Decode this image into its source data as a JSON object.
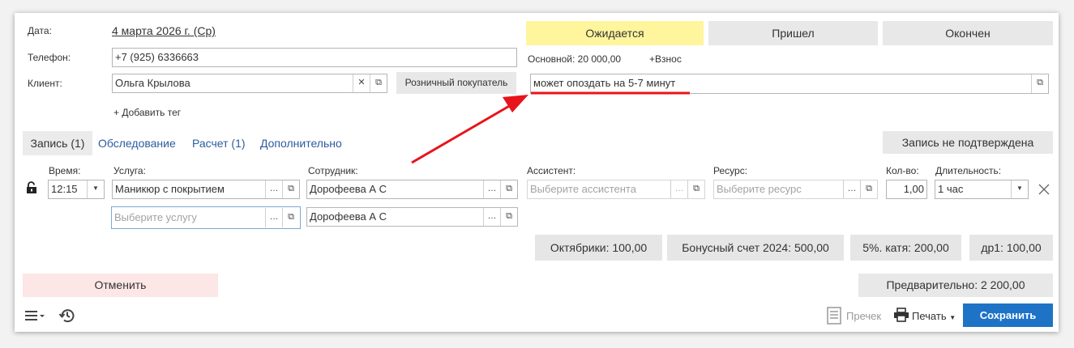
{
  "header": {
    "date_label": "Дата:",
    "date_value": "4 марта 2026 г. (Ср)",
    "phone_label": "Телефон:",
    "phone_value": "+7 (925) 6336663",
    "client_label": "Клиент:",
    "client_value": "Ольга Крылова",
    "client_type_button": "Розничный покупатель",
    "add_tag": "+ Добавить тег"
  },
  "status": {
    "options": [
      "Ожидается",
      "Пришел",
      "Окончен"
    ],
    "selected": "Ожидается",
    "basic_label": "Основной: 20 000,00",
    "deposit_link": "+Взнос",
    "comment": "может опоздать на 5-7 минут"
  },
  "tabs": [
    {
      "label": "Запись (1)",
      "active": true
    },
    {
      "label": "Обследование",
      "active": false
    },
    {
      "label": "Расчет (1)",
      "active": false
    },
    {
      "label": "Дополнительно",
      "active": false
    }
  ],
  "confirm_button": "Запись не подтверждена",
  "columns": {
    "time": "Время:",
    "service": "Услуга:",
    "employee": "Сотрудник:",
    "assistant": "Ассистент:",
    "resource": "Ресурс:",
    "qty": "Кол-во:",
    "duration": "Длительность:"
  },
  "rows": [
    {
      "time": "12:15",
      "service": "Маникюр с покрытием",
      "employee": "Дорофеева А С",
      "assistant_placeholder": "Выберите ассистента",
      "resource_placeholder": "Выберите ресурс",
      "qty": "1,00",
      "duration": "1 час"
    },
    {
      "service_placeholder": "Выберите услугу",
      "employee": "Дорофеева А С"
    }
  ],
  "balances": [
    "Октябрики: 100,00",
    "Бонусный счет 2024: 500,00",
    "5%. катя: 200,00",
    "др1: 100,00"
  ],
  "cancel_button": "Отменить",
  "preliminary": "Предварительно: 2 200,00",
  "footer": {
    "receipt_label": "Пречек",
    "print_label": "Печать",
    "save_label": "Сохранить"
  },
  "colors": {
    "selected_status": "#fff59d",
    "cancel_bg": "#fde6e6",
    "save_bg": "#1e73c6",
    "link": "#2c5c9e",
    "annotation": "#e8141b"
  }
}
